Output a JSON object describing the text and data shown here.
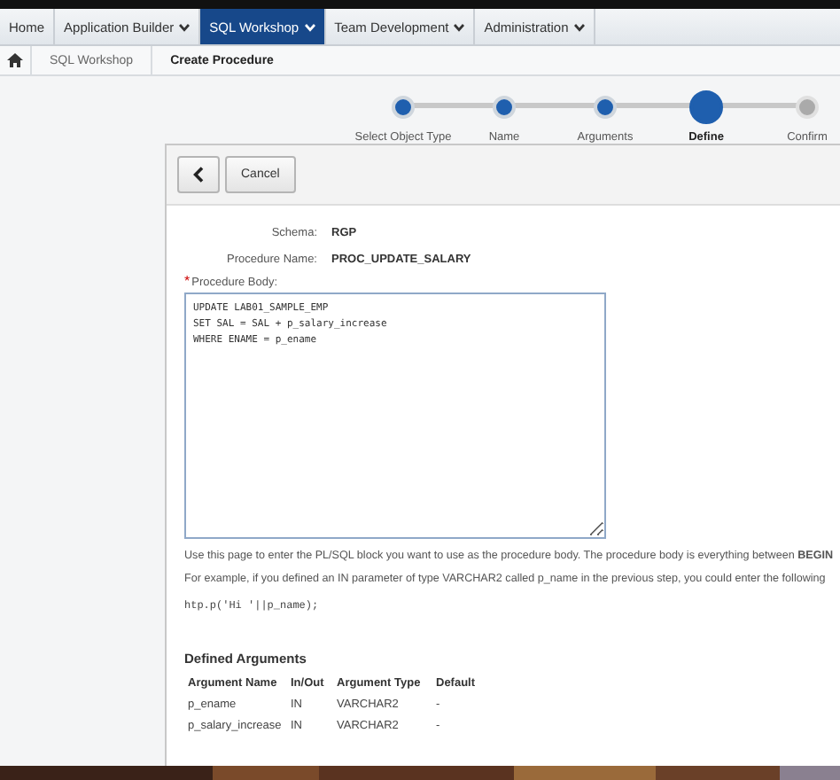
{
  "nav": {
    "tabs": [
      {
        "label": "Home",
        "selected": false,
        "menu": false
      },
      {
        "label": "Application Builder",
        "selected": false,
        "menu": true
      },
      {
        "label": "SQL Workshop",
        "selected": true,
        "menu": true
      },
      {
        "label": "Team Development",
        "selected": false,
        "menu": true
      },
      {
        "label": "Administration",
        "selected": false,
        "menu": true
      }
    ]
  },
  "breadcrumb": [
    "SQL Workshop",
    "Create Procedure"
  ],
  "wizard": {
    "steps": [
      {
        "label": "Select Object Type",
        "completed": true,
        "current": false
      },
      {
        "label": "Name",
        "completed": true,
        "current": false
      },
      {
        "label": "Arguments",
        "completed": true,
        "current": false
      },
      {
        "label": "Define",
        "completed": false,
        "current": true
      },
      {
        "label": "Confirm",
        "completed": false,
        "current": false
      }
    ]
  },
  "toolbar": {
    "cancel": "Cancel"
  },
  "fields": [
    {
      "label": "Schema:",
      "value": "RGP"
    },
    {
      "label": "Procedure Name:",
      "value": "PROC_UPDATE_SALARY"
    }
  ],
  "body": {
    "label": "Procedure Body:",
    "required_mark": "*",
    "value": "UPDATE LAB01_SAMPLE_EMP\nSET SAL = SAL + p_salary_increase\nWHERE ENAME = p_ename"
  },
  "help": [
    "Use this page to enter the PL/SQL block you want to use as the procedure body. The procedure body is everything between **BEGIN**",
    "For example, if you defined an IN parameter of type VARCHAR2 called p_name in the previous step, you could enter the following"
  ],
  "example_code": "htp.p('Hi '||p_name);",
  "arguments": {
    "title": "Defined Arguments",
    "columns": [
      "Argument Name",
      "In/Out",
      "Argument Type",
      "Default"
    ],
    "rows": [
      [
        "p_ename",
        "IN",
        "VARCHAR2",
        "-"
      ],
      [
        "p_salary_increase",
        "IN",
        "VARCHAR2",
        "-"
      ]
    ]
  }
}
